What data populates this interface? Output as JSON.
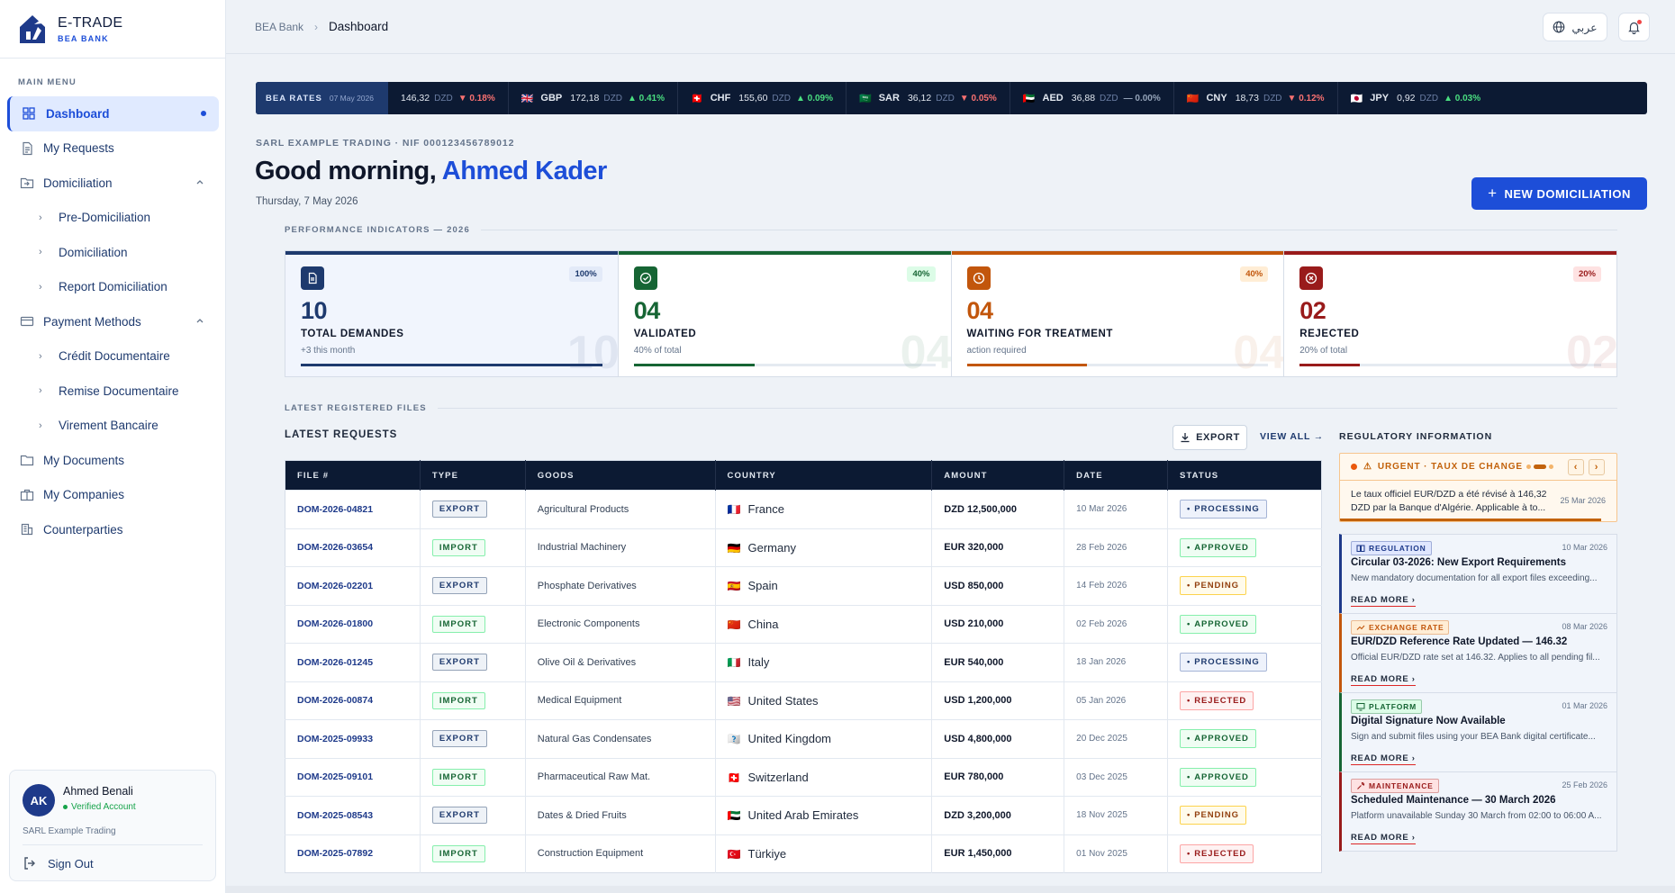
{
  "brand": {
    "name": "E-TRADE",
    "sub": "BEA BANK"
  },
  "sidebar": {
    "menu_label": "MAIN MENU",
    "items": [
      {
        "label": "Dashboard",
        "icon": "grid-icon",
        "active": true
      },
      {
        "label": "My Requests",
        "icon": "document-icon"
      },
      {
        "label": "Domiciliation",
        "icon": "folder-in-icon",
        "expanded": true
      },
      {
        "label": "Pre-Domiciliation",
        "sub": true
      },
      {
        "label": "Domiciliation",
        "sub": true
      },
      {
        "label": "Report Domiciliation",
        "sub": true
      },
      {
        "label": "Payment Methods",
        "icon": "card-icon",
        "expanded": true
      },
      {
        "label": "Crédit Documentaire",
        "sub": true
      },
      {
        "label": "Remise Documentaire",
        "sub": true
      },
      {
        "label": "Virement Bancaire",
        "sub": true
      },
      {
        "label": "My Documents",
        "icon": "folder-icon"
      },
      {
        "label": "My Companies",
        "icon": "briefcase-icon"
      },
      {
        "label": "Counterparties",
        "icon": "building-icon"
      }
    ]
  },
  "user": {
    "initials": "AK",
    "name": "Ahmed Benali",
    "status": "Verified Account",
    "company": "SARL Example Trading",
    "signout": "Sign Out"
  },
  "topbar": {
    "breadcrumb_root": "BEA Bank",
    "breadcrumb_current": "Dashboard",
    "lang": "عربي"
  },
  "ticker": {
    "title": "BEA RATES",
    "date": "07 May 2026",
    "first": {
      "value": "146,32",
      "unit": "DZD",
      "change": "▼ 0.18%",
      "dir": "down"
    },
    "items": [
      {
        "flag": "🇬🇧",
        "code": "GBP",
        "value": "172,18",
        "unit": "DZD",
        "change": "▲ 0.41%",
        "dir": "up"
      },
      {
        "flag": "🇨🇭",
        "code": "CHF",
        "value": "155,60",
        "unit": "DZD",
        "change": "▲ 0.09%",
        "dir": "up"
      },
      {
        "flag": "🇸🇦",
        "code": "SAR",
        "value": "36,12",
        "unit": "DZD",
        "change": "▼ 0.05%",
        "dir": "down"
      },
      {
        "flag": "🇦🇪",
        "code": "AED",
        "value": "36,88",
        "unit": "DZD",
        "change": "— 0.00%",
        "dir": "flat"
      },
      {
        "flag": "🇨🇳",
        "code": "CNY",
        "value": "18,73",
        "unit": "DZD",
        "change": "▼ 0.12%",
        "dir": "down"
      },
      {
        "flag": "🇯🇵",
        "code": "JPY",
        "value": "0,92",
        "unit": "DZD",
        "change": "▲ 0.03%",
        "dir": "up"
      }
    ]
  },
  "header": {
    "company_line": "SARL EXAMPLE TRADING · NIF 000123456789012",
    "greeting": "Good morning,",
    "user_name": "Ahmed Kader",
    "date": "Thursday, 7 May 2026",
    "new_button": "NEW DOMICILIATION"
  },
  "kpi_section": "PERFORMANCE INDICATORS — 2026",
  "kpis": [
    {
      "value": "10",
      "label": "TOTAL DEMANDES",
      "sub": "+3 this month",
      "pct": "100%",
      "progress": 1.0,
      "color": "#1e3a6e",
      "bg": "#f1f5fd",
      "pctbg": "#e3eaf8",
      "icon": "file-icon"
    },
    {
      "value": "04",
      "label": "VALIDATED",
      "sub": "40% of total",
      "pct": "40%",
      "progress": 0.4,
      "color": "#166534",
      "bg": "#ffffff",
      "pctbg": "#dcfce7",
      "icon": "check-circle-icon"
    },
    {
      "value": "04",
      "label": "WAITING FOR TREATMENT",
      "sub": "action required",
      "pct": "40%",
      "progress": 0.4,
      "color": "#c2560c",
      "bg": "#ffffff",
      "pctbg": "#ffedd5",
      "icon": "clock-icon"
    },
    {
      "value": "02",
      "label": "REJECTED",
      "sub": "20% of total",
      "pct": "20%",
      "progress": 0.2,
      "color": "#991b1b",
      "bg": "#ffffff",
      "pctbg": "#fee2e2",
      "icon": "x-circle-icon"
    }
  ],
  "files_section": "LATEST REGISTERED FILES",
  "requests": {
    "title": "LATEST REQUESTS",
    "export_label": "EXPORT",
    "view_all": "VIEW ALL →",
    "columns": [
      "FILE #",
      "TYPE",
      "GOODS",
      "COUNTRY",
      "AMOUNT",
      "DATE",
      "STATUS"
    ],
    "rows": [
      {
        "id": "DOM-2026-04821",
        "type": "EXPORT",
        "goods": "Agricultural Products",
        "flag": "🇫🇷",
        "country": "France",
        "amount": "DZD 12,500,000",
        "date": "10 Mar 2026",
        "status": "PROCESSING"
      },
      {
        "id": "DOM-2026-03654",
        "type": "IMPORT",
        "goods": "Industrial Machinery",
        "flag": "🇩🇪",
        "country": "Germany",
        "amount": "EUR 320,000",
        "date": "28 Feb 2026",
        "status": "APPROVED"
      },
      {
        "id": "DOM-2026-02201",
        "type": "EXPORT",
        "goods": "Phosphate Derivatives",
        "flag": "🇪🇸",
        "country": "Spain",
        "amount": "USD 850,000",
        "date": "14 Feb 2026",
        "status": "PENDING"
      },
      {
        "id": "DOM-2026-01800",
        "type": "IMPORT",
        "goods": "Electronic Components",
        "flag": "🇨🇳",
        "country": "China",
        "amount": "USD 210,000",
        "date": "02 Feb 2026",
        "status": "APPROVED"
      },
      {
        "id": "DOM-2026-01245",
        "type": "EXPORT",
        "goods": "Olive Oil & Derivatives",
        "flag": "🇮🇹",
        "country": "Italy",
        "amount": "EUR 540,000",
        "date": "18 Jan 2026",
        "status": "PROCESSING"
      },
      {
        "id": "DOM-2026-00874",
        "type": "IMPORT",
        "goods": "Medical Equipment",
        "flag": "🇺🇸",
        "country": "United States",
        "amount": "USD 1,200,000",
        "date": "05 Jan 2026",
        "status": "REJECTED"
      },
      {
        "id": "DOM-2025-09933",
        "type": "EXPORT",
        "goods": "Natural Gas Condensates",
        "flag": "🇺🇰",
        "country": "United Kingdom",
        "amount": "USD 4,800,000",
        "date": "20 Dec 2025",
        "status": "APPROVED"
      },
      {
        "id": "DOM-2025-09101",
        "type": "IMPORT",
        "goods": "Pharmaceutical Raw Mat.",
        "flag": "🇨🇭",
        "country": "Switzerland",
        "amount": "EUR 780,000",
        "date": "03 Dec 2025",
        "status": "APPROVED"
      },
      {
        "id": "DOM-2025-08543",
        "type": "EXPORT",
        "goods": "Dates & Dried Fruits",
        "flag": "🇦🇪",
        "country": "United Arab Emirates",
        "amount": "DZD 3,200,000",
        "date": "18 Nov 2025",
        "status": "PENDING"
      },
      {
        "id": "DOM-2025-07892",
        "type": "IMPORT",
        "goods": "Construction Equipment",
        "flag": "🇹🇷",
        "country": "Türkiye",
        "amount": "EUR 1,450,000",
        "date": "01 Nov 2025",
        "status": "REJECTED"
      }
    ]
  },
  "regulatory": {
    "title": "REGULATORY INFORMATION",
    "urgent": {
      "label": "URGENT · TAUX DE CHANGE",
      "text": "Le taux officiel EUR/DZD a été révisé à 146,32 DZD par la Banque d'Algérie. Applicable à to...",
      "date": "25 Mar 2026"
    },
    "news": [
      {
        "tag": "REGULATION",
        "date": "10 Mar 2026",
        "title": "Circular 03-2026: New Export Requirements",
        "body": "New mandatory documentation for all export files exceeding...",
        "read": "READ MORE ›",
        "color": "#1e3a8a",
        "tagbg": "#e0e7ff",
        "icon": "book-icon"
      },
      {
        "tag": "EXCHANGE RATE",
        "date": "08 Mar 2026",
        "title": "EUR/DZD Reference Rate Updated — 146.32",
        "body": "Official EUR/DZD rate set at 146.32. Applies to all pending fil...",
        "read": "READ MORE ›",
        "color": "#c2560c",
        "tagbg": "#ffedd5",
        "icon": "trend-icon"
      },
      {
        "tag": "PLATFORM",
        "date": "01 Mar 2026",
        "title": "Digital Signature Now Available",
        "body": "Sign and submit files using your BEA Bank digital certificate...",
        "read": "READ MORE ›",
        "color": "#166534",
        "tagbg": "#dcfce7",
        "icon": "monitor-icon"
      },
      {
        "tag": "MAINTENANCE",
        "date": "25 Feb 2026",
        "title": "Scheduled Maintenance — 30 March 2026",
        "body": "Platform unavailable Sunday 30 March from 02:00 to 06:00 A...",
        "read": "READ MORE ›",
        "color": "#991b1b",
        "tagbg": "#fee2e2",
        "icon": "wrench-icon"
      }
    ]
  }
}
